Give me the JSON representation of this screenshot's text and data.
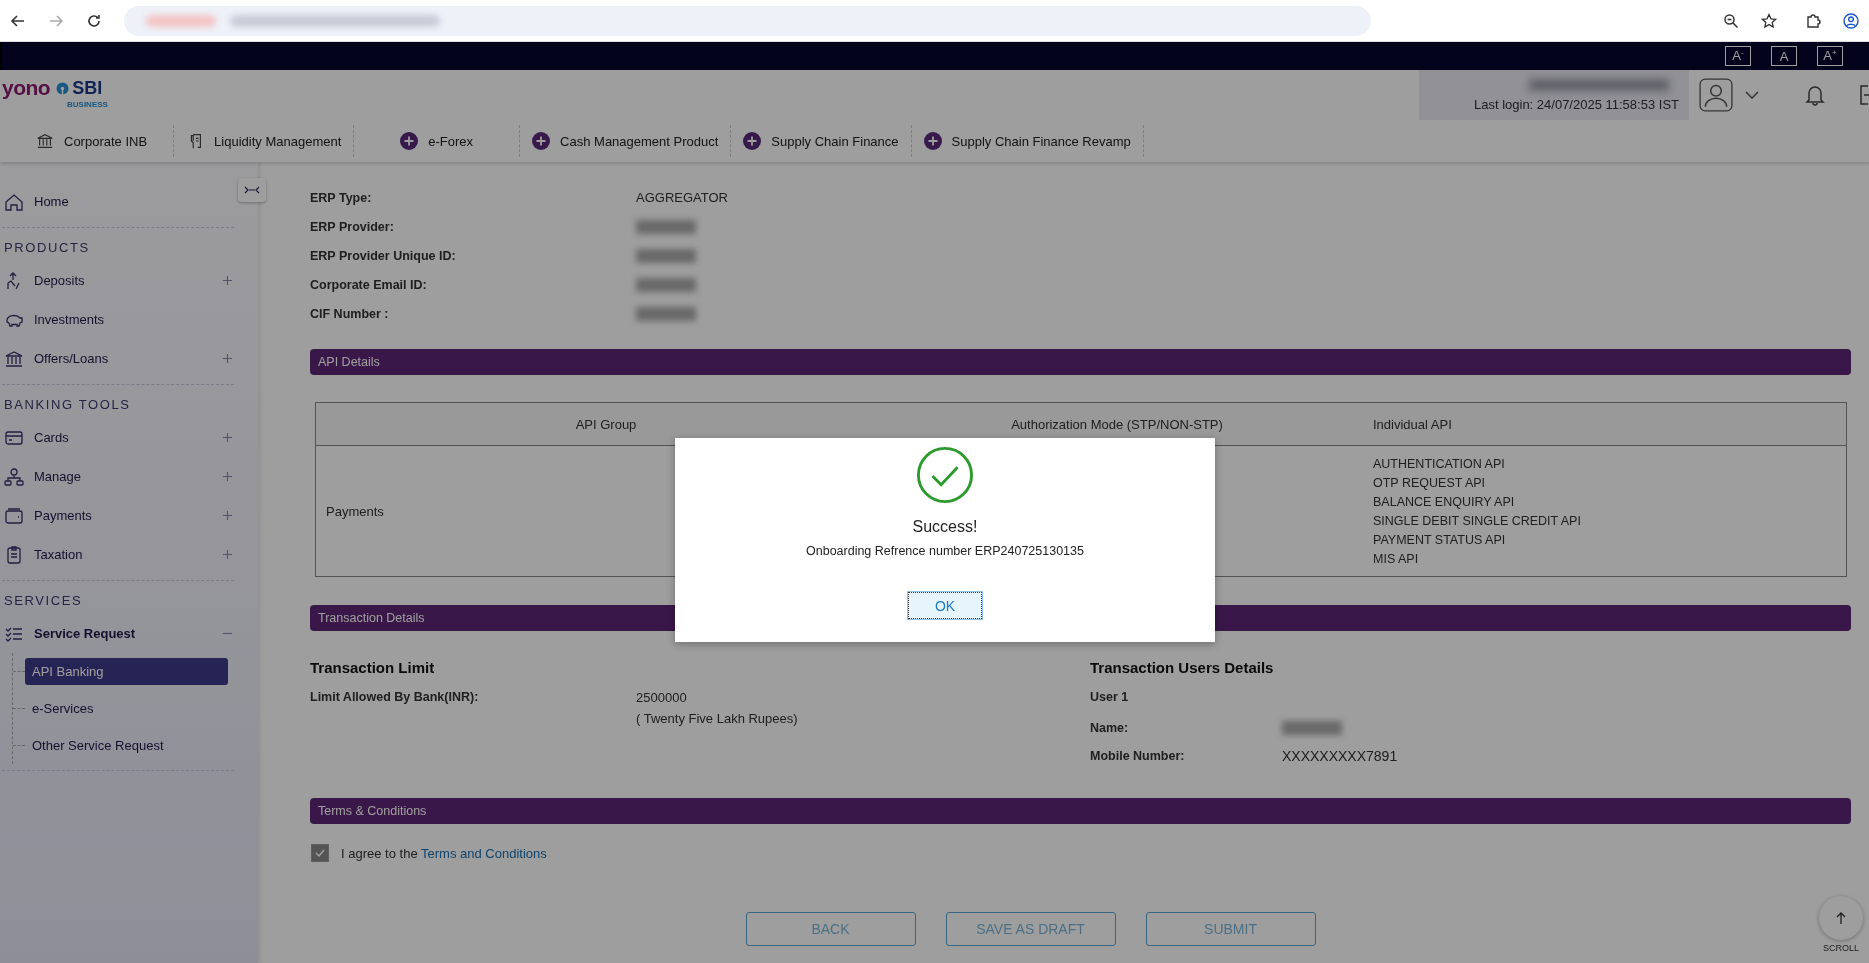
{
  "topbar": {
    "font_buttons": [
      "A$^{-}$",
      "A",
      "A$^{+}$"
    ]
  },
  "header": {
    "logo": {
      "word": "yono",
      "bank": "SBI",
      "tag": "BUSINESS"
    },
    "last_login": "Last login: 24/07/2025 11:58:53 IST"
  },
  "nav_tabs": [
    {
      "label": "Corporate INB",
      "kind": "bank"
    },
    {
      "label": "Liquidity Management",
      "kind": "touch"
    },
    {
      "label": "e-Forex",
      "kind": "plus"
    },
    {
      "label": "Cash Management Product",
      "kind": "plus"
    },
    {
      "label": "Supply Chain Finance",
      "kind": "plus"
    },
    {
      "label": "Supply Chain Finance Revamp",
      "kind": "plus"
    }
  ],
  "sidebar": {
    "sections": [
      {
        "items": [
          {
            "label": "Home",
            "kind": "home"
          }
        ]
      },
      {
        "title": "PRODUCTS",
        "items": [
          {
            "label": "Deposits",
            "kind": "deposit",
            "expanded": false
          },
          {
            "label": "Investments",
            "kind": "piggy"
          },
          {
            "label": "Offers/Loans",
            "kind": "bank",
            "expanded": false
          }
        ]
      },
      {
        "title": "BANKING TOOLS",
        "items": [
          {
            "label": "Cards",
            "kind": "card",
            "expanded": false
          },
          {
            "label": "Manage",
            "kind": "manage",
            "expanded": false
          },
          {
            "label": "Payments",
            "kind": "wallet",
            "expanded": false
          },
          {
            "label": "Taxation",
            "kind": "tax",
            "expanded": false
          }
        ]
      },
      {
        "title": "SERVICES",
        "items": [
          {
            "label": "Service Request",
            "kind": "checklist",
            "expanded": true,
            "children": [
              {
                "label": "API Banking",
                "selected": true
              },
              {
                "label": "e-Services",
                "selected": false
              },
              {
                "label": "Other Service Request",
                "selected": false
              }
            ]
          }
        ]
      }
    ]
  },
  "erp_fields": [
    {
      "label": "ERP Type:",
      "value": "AGGREGATOR"
    },
    {
      "label": "ERP Provider:",
      "redacted": true
    },
    {
      "label": "ERP Provider Unique ID:",
      "redacted": true
    },
    {
      "label": "Corporate Email ID:",
      "redacted": true
    },
    {
      "label": "CIF Number :",
      "redacted": true
    }
  ],
  "api_details": {
    "title": "API Details",
    "columns": [
      "API Group",
      "Authorization Mode (STP/NON-STP)",
      "Individual API"
    ],
    "rows": [
      {
        "group": "Payments",
        "apis": [
          "AUTHENTICATION API",
          "OTP REQUEST API",
          "BALANCE ENQUIRY API",
          "SINGLE DEBIT SINGLE CREDIT API",
          "PAYMENT STATUS API",
          "MIS API"
        ]
      }
    ]
  },
  "transaction_details": {
    "title": "Transaction Details",
    "limit": {
      "heading": "Transaction Limit",
      "label": "Limit Allowed By Bank(INR):",
      "value": "2500000",
      "words": "( Twenty Five Lakh Rupees)"
    },
    "users": {
      "heading": "Transaction Users Details",
      "user": "User 1",
      "fields": [
        {
          "label": "Name:",
          "redacted": true
        },
        {
          "label": "Mobile Number:",
          "value": "XXXXXXXXX7891"
        }
      ]
    }
  },
  "terms": {
    "title": "Terms & Conditions",
    "checked": true,
    "text": "I agree to the ",
    "link": "Terms and Conditions"
  },
  "buttons": [
    "BACK",
    "SAVE AS DRAFT",
    "SUBMIT"
  ],
  "scroll_button": {
    "label": "SCROLL"
  },
  "modal": {
    "title": "Success!",
    "message": "Onboarding Refrence number ERP240725130135",
    "ok": "OK"
  }
}
